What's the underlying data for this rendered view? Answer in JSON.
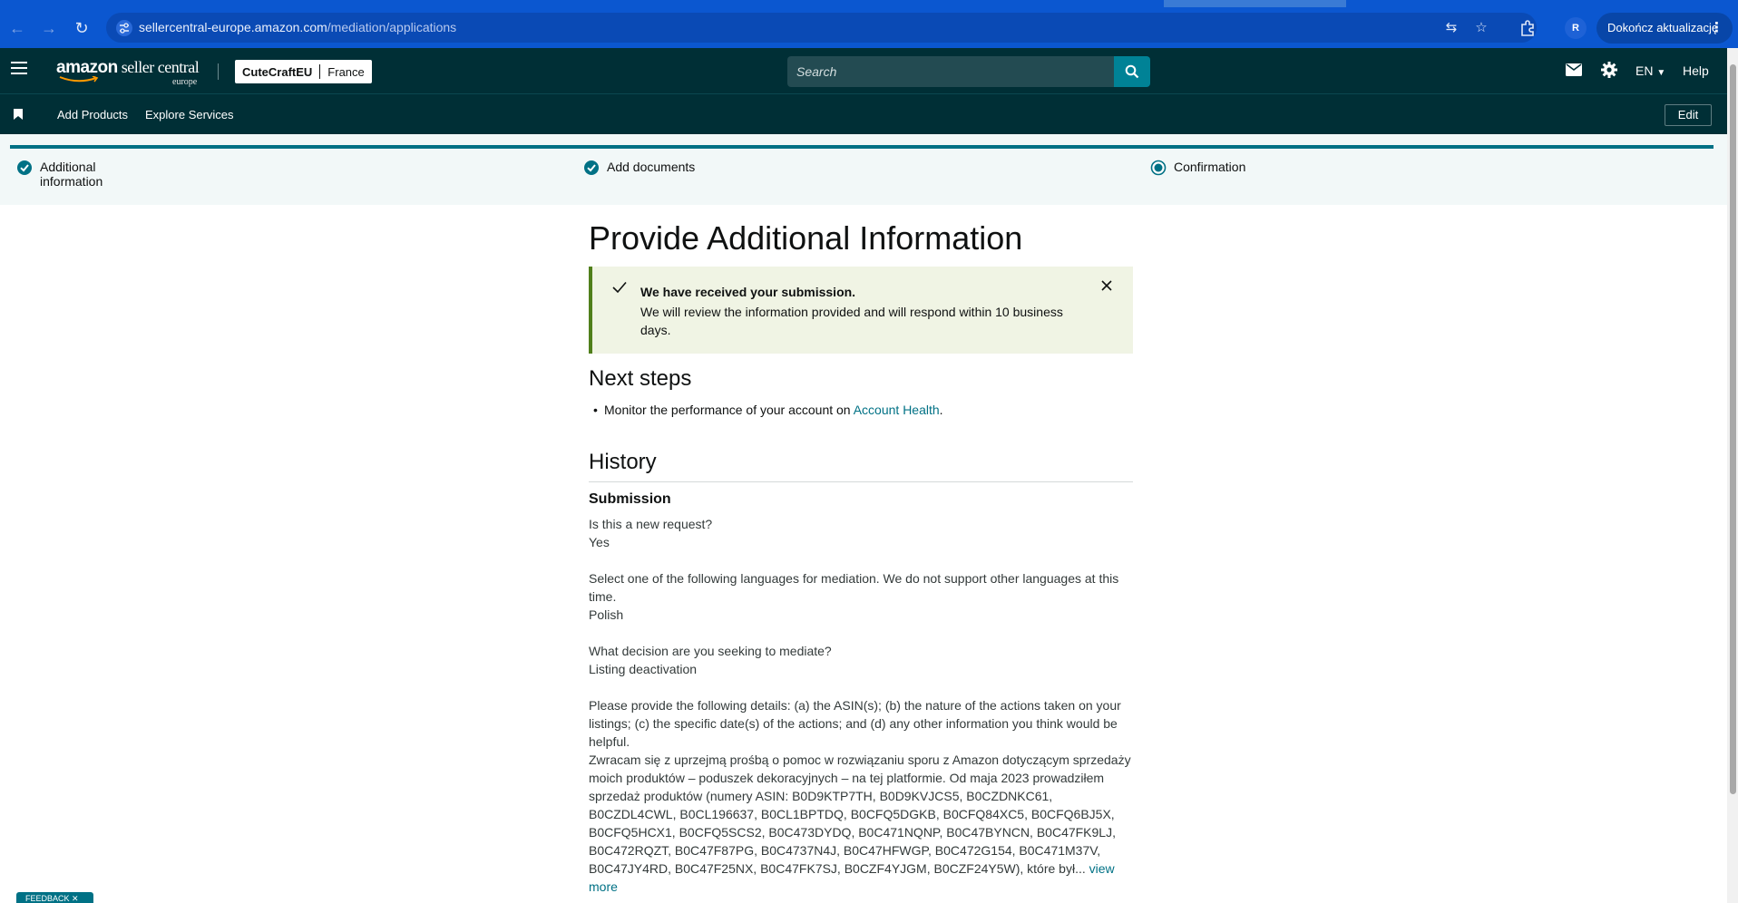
{
  "browser": {
    "url_host": "sellercentral-europe.amazon.com",
    "url_path": "/mediation/applications",
    "profile_initial": "R",
    "update_label": "Dokończ aktualizację"
  },
  "header": {
    "logo_brand": "amazon",
    "logo_product": " seller central",
    "logo_region": "europe",
    "store_name": "CuteCraftEU",
    "marketplace": "France",
    "search_placeholder": "Search",
    "language": "EN",
    "help_label": "Help"
  },
  "subnav": {
    "links": [
      "Add Products",
      "Explore Services"
    ],
    "edit_label": "Edit"
  },
  "stepper": {
    "steps": [
      {
        "label_line1": "Additional",
        "label_line2": "information",
        "state": "done"
      },
      {
        "label_line1": "Add documents",
        "label_line2": "",
        "state": "done"
      },
      {
        "label_line1": "Confirmation",
        "label_line2": "",
        "state": "current"
      }
    ]
  },
  "main": {
    "title": "Provide Additional Information",
    "alert": {
      "title": "We have received your submission.",
      "body": "We will review the information provided and will respond within 10 business days."
    },
    "next_steps": {
      "heading": "Next steps",
      "item_text": "Monitor the performance of your account on ",
      "item_link": "Account Health",
      "item_suffix": "."
    },
    "history": {
      "heading": "History",
      "subheading": "Submission",
      "q1": "Is this a new request?",
      "a1": "Yes",
      "q2": "Select one of the following languages for mediation. We do not support other languages at this time.",
      "a2": "Polish",
      "q3": "What decision are you seeking to mediate?",
      "a3": "Listing deactivation",
      "q4": "Please provide the following details: (a) the ASIN(s); (b) the nature of the actions taken on your listings; (c) the specific date(s) of the actions; and (d) any other information you think would be helpful.",
      "a4": "Zwracam się z uprzejmą prośbą o pomoc w rozwiązaniu sporu z Amazon dotyczącym sprzedaży moich produktów – poduszek dekoracyjnych – na tej platformie. Od maja 2023 prowadziłem sprzedaż produktów (numery ASIN: B0D9KTP7TH, B0D9KVJCS5, B0CZDNKC61, B0CZDL4CWL, B0CL196637, B0CL1BPTDQ, B0CFQ5DGKB, B0CFQ84XC5, B0CFQ6BJ5X, B0CFQ5HCX1, B0CFQ5SCS2, B0C473DYDQ, B0C471NQNP, B0C47BYNCN, B0C47FK9LJ, B0C472RQZT, B0C47F87PG, B0C4737N4J, B0C47HFWGP, B0C472G154, B0C471M37V, B0C47JY4RD, B0C47F25NX, B0C47FK7SJ, B0CZF4YJGM, B0CZF24Y5W), które był...",
      "view_more": "view more"
    }
  },
  "feedback_label": "FEEDBACK ✕",
  "colors": {
    "header_bg": "#002f36",
    "accent": "#008296",
    "link": "#007185",
    "success_border": "#507f1b",
    "success_bg": "#f0f4e4",
    "browser_bar": "#0b57d0"
  }
}
